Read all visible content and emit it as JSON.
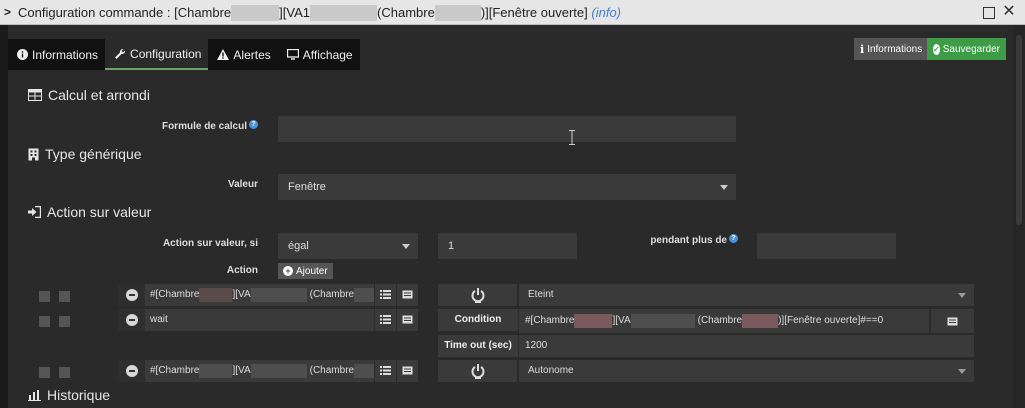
{
  "window": {
    "chevron": ">",
    "title_prefix": "Configuration commande : [Chambre",
    "title_part2": "][VA1",
    "title_part3": "(Chambre",
    "title_part4": ")][Fenêtre ouverte]",
    "title_info": "(info)"
  },
  "tabs": [
    {
      "label": "Informations",
      "icon": "info-circle-icon"
    },
    {
      "label": "Configuration",
      "icon": "wrench-icon",
      "active": true
    },
    {
      "label": "Alertes",
      "icon": "warning-triangle-icon"
    },
    {
      "label": "Affichage",
      "icon": "monitor-icon"
    }
  ],
  "header_buttons": {
    "info_label": "Informations",
    "save_label": "Sauvegarder"
  },
  "sections": {
    "calcul": "Calcul et arrondi",
    "type": "Type générique",
    "action": "Action sur valeur",
    "historique": "Historique"
  },
  "form": {
    "formule_label": "Formule de calcul",
    "formule_value": "",
    "valeur_label": "Valeur",
    "valeur_selected": "Fenêtre",
    "action_si_label": "Action sur valeur, si",
    "operator_selected": "égal",
    "compare_value": "1",
    "pendant_label": "pendant plus de",
    "pendant_value": "",
    "action_label": "Action",
    "ajouter_label": "Ajouter"
  },
  "actions": [
    {
      "cmd_a": "#[Chambre",
      "cmd_b": "][VA",
      "cmd_c": "(Chambre",
      "state": "Eteint"
    },
    {
      "cmd_a": "wait",
      "condition_label": "Condition",
      "condition_a": "#[Chambre",
      "condition_b": "][VA",
      "condition_c": "(Chambre",
      "condition_d": ")][Fenêtre ouverte]#==0",
      "timeout_label": "Time out (sec)",
      "timeout_value": "1200"
    },
    {
      "cmd_a": "#[Chambre",
      "cmd_b": "][VA",
      "cmd_c": "(Chambre",
      "state": "Autonome"
    }
  ],
  "colors": {
    "accent_green": "#3e9c47",
    "tab_active_underline": "#6fa36a",
    "link_info": "#4a7ec8",
    "redaction_mauve": "#7a5a5a",
    "redaction_gray": "#b0b0b0"
  }
}
